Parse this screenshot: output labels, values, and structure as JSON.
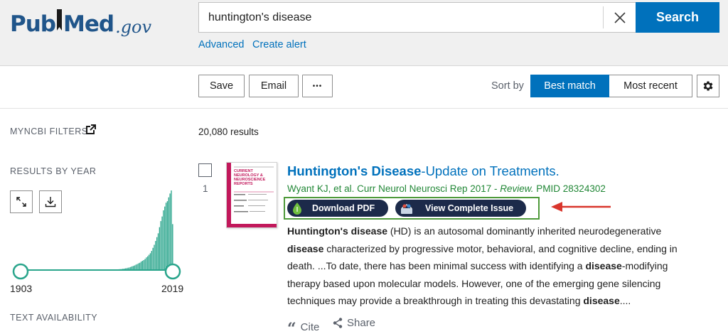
{
  "brand": {
    "pub": "Pub",
    "med": "Med",
    "gov": ".gov"
  },
  "search": {
    "query": "huntington's disease",
    "button_label": "Search"
  },
  "header_links": {
    "advanced": "Advanced",
    "create_alert": "Create alert"
  },
  "toolbar": {
    "save": "Save",
    "email": "Email",
    "more": "•••",
    "sort_by_label": "Sort by",
    "sort_options": [
      "Best match",
      "Most recent"
    ],
    "active_sort": "Best match"
  },
  "sidebar": {
    "myncbi_filters": "MYNCBI FILTERS",
    "results_by_year": "RESULTS BY YEAR",
    "year_start": "1903",
    "year_end": "2019",
    "text_availability": "TEXT AVAILABILITY"
  },
  "results": {
    "count": "20,080 results",
    "items": [
      {
        "number": "1",
        "title_bold": "Huntington's Disease",
        "title_rest": "-Update on Treatments.",
        "authors_journal": "Wyant KJ, et al. Curr Neurol Neurosci Rep 2017 - ",
        "pub_type": "Review.",
        "pmid": " PMID 28324302",
        "thumbnail_text": [
          "CURRENT",
          "NEUROLOGY &",
          "NEUROSCIENCE",
          "REPORTS"
        ],
        "buttons": {
          "download_pdf": "Download PDF",
          "view_issue": "View Complete Issue"
        },
        "abstract": [
          {
            "t": "Huntington's disease",
            "b": true
          },
          {
            "t": " (HD) is an autosomal dominantly inherited neurodegenerative ",
            "b": false
          },
          {
            "t": "disease",
            "b": true
          },
          {
            "t": " characterized by progressive motor, behavioral, and cognitive decline, ending in death. ...To date, there has been minimal success with identifying a ",
            "b": false
          },
          {
            "t": "disease",
            "b": true
          },
          {
            "t": "-modifying therapy based upon molecular models. However, one of the emerging gene silencing techniques may provide a breakthrough in treating this devastating ",
            "b": false
          },
          {
            "t": "disease",
            "b": true
          },
          {
            "t": "....",
            "b": false
          }
        ],
        "actions": {
          "cite": "Cite",
          "share": "Share"
        }
      }
    ]
  },
  "colors": {
    "brand_blue": "#20558a",
    "link_blue": "#0071bc",
    "citation_green": "#218736",
    "histogram_teal": "#2aa58c",
    "annotation_red": "#d9352c",
    "annotation_green": "#4e9a3a",
    "pill_navy": "#1c2a4a"
  },
  "histogram_counts_by_year": [
    1,
    1,
    1,
    1,
    1,
    1,
    1,
    1,
    1,
    1,
    1,
    1,
    1,
    1,
    1,
    1,
    1,
    1,
    1,
    1,
    1,
    1,
    1,
    1,
    1,
    1,
    1,
    1,
    1,
    1,
    1,
    1,
    1,
    1,
    1,
    1,
    1,
    1,
    1,
    1,
    1,
    1,
    1,
    1,
    1,
    1,
    1,
    1,
    1,
    1,
    1,
    2,
    2,
    2,
    2,
    2,
    2,
    2,
    2,
    2,
    3,
    3,
    3,
    3,
    4,
    4,
    4,
    5,
    5,
    5,
    6,
    6,
    7,
    8,
    9,
    10,
    12,
    13,
    16,
    18,
    22,
    25,
    30,
    34,
    40,
    48,
    53,
    60,
    70,
    78,
    88,
    95,
    110,
    120,
    130,
    145,
    165,
    180,
    200,
    220,
    250,
    290,
    330,
    380,
    430,
    480,
    560,
    640,
    700,
    780,
    830,
    880,
    900,
    950,
    1000,
    1040,
    600
  ]
}
